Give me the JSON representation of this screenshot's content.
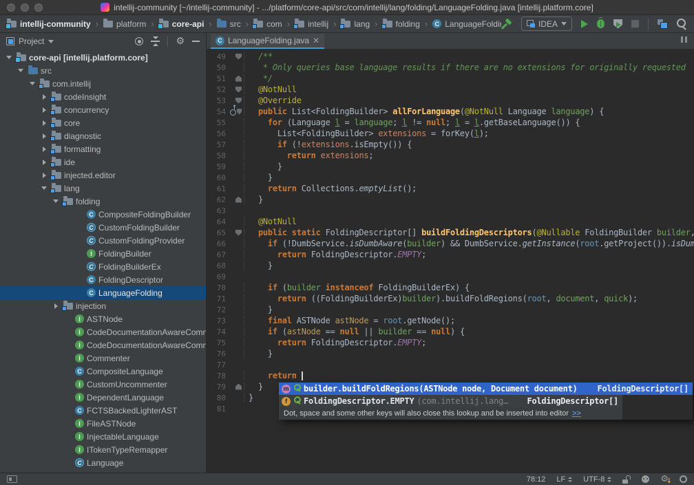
{
  "colors": {
    "editor_bg": "#2B2B2B",
    "panel_bg": "#3C3F41",
    "tab_underline": "#3C9CD7",
    "popup_selection": "#2F65CA",
    "tree_selection": "#15497A",
    "run_green": "#4DA54D",
    "keyword_orange": "#CC7832",
    "comment_green": "#629755",
    "annotation_yellow": "#BBB529"
  },
  "title_bar": {
    "title": "intellij-community [~/intellij-community] - .../platform/core-api/src/com/intellij/lang/folding/LanguageFolding.java [intellij.platform.core]"
  },
  "navbar": {
    "breadcrumbs": [
      {
        "label": "intellij-community",
        "icon": "module-folder",
        "bold": true
      },
      {
        "label": "platform",
        "icon": "folder"
      },
      {
        "label": "core-api",
        "icon": "module-folder",
        "bold": true
      },
      {
        "label": "src",
        "icon": "src-folder"
      },
      {
        "label": "com",
        "icon": "package-folder"
      },
      {
        "label": "intellij",
        "icon": "package-folder"
      },
      {
        "label": "lang",
        "icon": "package-folder"
      },
      {
        "label": "folding",
        "icon": "package-folder"
      },
      {
        "label": "LanguageFolding",
        "icon": "class"
      }
    ],
    "run_config": "IDEA"
  },
  "project_panel": {
    "title": "Project",
    "tree": [
      {
        "lvl": 0,
        "arrow": "d",
        "icon": "module-folder",
        "label": "core-api [intellij.platform.core]",
        "bold": true
      },
      {
        "lvl": 1,
        "arrow": "d",
        "icon": "src-folder",
        "label": "src"
      },
      {
        "lvl": 2,
        "arrow": "d",
        "icon": "package-folder",
        "label": "com.intellij"
      },
      {
        "lvl": 3,
        "arrow": "r",
        "icon": "package-folder",
        "label": "codeInsight"
      },
      {
        "lvl": 3,
        "arrow": "r",
        "icon": "package-folder",
        "label": "concurrency"
      },
      {
        "lvl": 3,
        "arrow": "r",
        "icon": "package-folder",
        "label": "core"
      },
      {
        "lvl": 3,
        "arrow": "r",
        "icon": "package-folder",
        "label": "diagnostic"
      },
      {
        "lvl": 3,
        "arrow": "r",
        "icon": "package-folder",
        "label": "formatting"
      },
      {
        "lvl": 3,
        "arrow": "r",
        "icon": "package-folder",
        "label": "ide"
      },
      {
        "lvl": 3,
        "arrow": "r",
        "icon": "package-folder",
        "label": "injected.editor"
      },
      {
        "lvl": 3,
        "arrow": "d",
        "icon": "package-folder",
        "label": "lang"
      },
      {
        "lvl": 4,
        "arrow": "d",
        "icon": "package-folder",
        "label": "folding"
      },
      {
        "lvl": 5,
        "arrow": "",
        "icon": "class",
        "label": "CompositeFoldingBuilder"
      },
      {
        "lvl": 5,
        "arrow": "",
        "icon": "abstract-class",
        "label": "CustomFoldingBuilder"
      },
      {
        "lvl": 5,
        "arrow": "",
        "icon": "abstract-class",
        "label": "CustomFoldingProvider"
      },
      {
        "lvl": 5,
        "arrow": "",
        "icon": "interface",
        "label": "FoldingBuilder"
      },
      {
        "lvl": 5,
        "arrow": "",
        "icon": "abstract-class",
        "label": "FoldingBuilderEx"
      },
      {
        "lvl": 5,
        "arrow": "",
        "icon": "class",
        "label": "FoldingDescriptor"
      },
      {
        "lvl": 5,
        "arrow": "",
        "icon": "class",
        "label": "LanguageFolding",
        "sel": true
      },
      {
        "lvl": 4,
        "arrow": "r",
        "icon": "package-folder",
        "label": "injection"
      },
      {
        "lvl": 4,
        "arrow": "",
        "icon": "interface",
        "label": "ASTNode"
      },
      {
        "lvl": 4,
        "arrow": "",
        "icon": "interface",
        "label": "CodeDocumentationAwareCommenter"
      },
      {
        "lvl": 4,
        "arrow": "",
        "icon": "interface",
        "label": "CodeDocumentationAwareCommenterEx"
      },
      {
        "lvl": 4,
        "arrow": "",
        "icon": "interface",
        "label": "Commenter"
      },
      {
        "lvl": 4,
        "arrow": "",
        "icon": "class",
        "label": "CompositeLanguage"
      },
      {
        "lvl": 4,
        "arrow": "",
        "icon": "interface",
        "label": "CustomUncommenter"
      },
      {
        "lvl": 4,
        "arrow": "",
        "icon": "interface",
        "label": "DependentLanguage"
      },
      {
        "lvl": 4,
        "arrow": "",
        "icon": "class",
        "label": "FCTSBackedLighterAST"
      },
      {
        "lvl": 4,
        "arrow": "",
        "icon": "interface",
        "label": "FileASTNode"
      },
      {
        "lvl": 4,
        "arrow": "",
        "icon": "interface",
        "label": "InjectableLanguage"
      },
      {
        "lvl": 4,
        "arrow": "",
        "icon": "interface",
        "label": "ITokenTypeRemapper"
      },
      {
        "lvl": 4,
        "arrow": "",
        "icon": "abstract-class",
        "label": "Language"
      }
    ]
  },
  "editor": {
    "tab": "LanguageFolding.java",
    "lines": [
      {
        "n": 49,
        "f": "s",
        "t": [
          [
            "p",
            "  "
          ],
          [
            "c",
            "/**"
          ]
        ]
      },
      {
        "n": 50,
        "t": [
          [
            "c",
            "   * Only queries base language results if there are no extensions for originally requested "
          ]
        ]
      },
      {
        "n": 51,
        "f": "e",
        "t": [
          [
            "c",
            "   */"
          ]
        ]
      },
      {
        "n": 52,
        "f": "s",
        "t": [
          [
            "p",
            "  "
          ],
          [
            "a",
            "@NotNull"
          ]
        ]
      },
      {
        "n": 53,
        "f": "s",
        "t": [
          [
            "p",
            "  "
          ],
          [
            "a",
            "@Override"
          ]
        ]
      },
      {
        "n": 54,
        "f": "s",
        "o": true,
        "t": [
          [
            "p",
            "  "
          ],
          [
            "k",
            "public"
          ],
          [
            "p",
            " List<FoldingBuilder> "
          ],
          [
            "m",
            "allForLanguage"
          ],
          [
            "p",
            "("
          ],
          [
            "a",
            "@NotNull"
          ],
          [
            "p",
            " Language "
          ],
          [
            "g",
            "language"
          ],
          [
            "p",
            ") {"
          ]
        ]
      },
      {
        "n": 55,
        "t": [
          [
            "p",
            "    "
          ],
          [
            "k",
            "for"
          ],
          [
            "p",
            " (Language "
          ],
          [
            "u",
            "l"
          ],
          [
            "p",
            " = "
          ],
          [
            "g",
            "language"
          ],
          [
            "p",
            "; "
          ],
          [
            "u",
            "l"
          ],
          [
            "p",
            " != "
          ],
          [
            "k",
            "null"
          ],
          [
            "p",
            "; "
          ],
          [
            "u",
            "l"
          ],
          [
            "p",
            " = "
          ],
          [
            "u",
            "l"
          ],
          [
            "p",
            ".getBaseLanguage()) {"
          ]
        ]
      },
      {
        "n": 56,
        "t": [
          [
            "p",
            "      List<FoldingBuilder> "
          ],
          [
            "s",
            "extensions"
          ],
          [
            "p",
            " = forKey("
          ],
          [
            "u",
            "l"
          ],
          [
            "p",
            ");"
          ]
        ]
      },
      {
        "n": 57,
        "t": [
          [
            "p",
            "      "
          ],
          [
            "k",
            "if"
          ],
          [
            "p",
            " (!"
          ],
          [
            "s",
            "extensions"
          ],
          [
            "p",
            ".isEmpty()) {"
          ]
        ]
      },
      {
        "n": 58,
        "t": [
          [
            "p",
            "        "
          ],
          [
            "k",
            "return"
          ],
          [
            "p",
            " "
          ],
          [
            "s",
            "extensions"
          ],
          [
            "p",
            ";"
          ]
        ]
      },
      {
        "n": 59,
        "t": [
          [
            "p",
            "      }"
          ]
        ]
      },
      {
        "n": 60,
        "t": [
          [
            "p",
            "    }"
          ]
        ]
      },
      {
        "n": 61,
        "t": [
          [
            "p",
            "    "
          ],
          [
            "k",
            "return"
          ],
          [
            "p",
            " Collections."
          ],
          [
            "i",
            "emptyList"
          ],
          [
            "p",
            "();"
          ]
        ]
      },
      {
        "n": 62,
        "f": "e",
        "t": [
          [
            "p",
            "  }"
          ]
        ]
      },
      {
        "n": 63,
        "t": []
      },
      {
        "n": 64,
        "t": [
          [
            "p",
            "  "
          ],
          [
            "a",
            "@NotNull"
          ]
        ]
      },
      {
        "n": 65,
        "f": "s",
        "t": [
          [
            "p",
            "  "
          ],
          [
            "k",
            "public static"
          ],
          [
            "p",
            " FoldingDescriptor[] "
          ],
          [
            "m",
            "buildFoldingDescriptors"
          ],
          [
            "p",
            "("
          ],
          [
            "a",
            "@Nullable"
          ],
          [
            "p",
            " FoldingBuilder "
          ],
          [
            "g",
            "builder"
          ],
          [
            "p",
            ", "
          ]
        ]
      },
      {
        "n": 66,
        "t": [
          [
            "p",
            "    "
          ],
          [
            "k",
            "if"
          ],
          [
            "p",
            " (!DumbService."
          ],
          [
            "i",
            "isDumbAware"
          ],
          [
            "p",
            "("
          ],
          [
            "g",
            "builder"
          ],
          [
            "p",
            ") && DumbService."
          ],
          [
            "i",
            "getInstance"
          ],
          [
            "p",
            "("
          ],
          [
            "r",
            "root"
          ],
          [
            "p",
            ".getProject())."
          ],
          [
            "i",
            "isDumb"
          ],
          [
            "p",
            "()"
          ]
        ]
      },
      {
        "n": 67,
        "t": [
          [
            "p",
            "      "
          ],
          [
            "k",
            "return"
          ],
          [
            "p",
            " FoldingDescriptor."
          ],
          [
            "e",
            "EMPTY"
          ],
          [
            "p",
            ";"
          ]
        ]
      },
      {
        "n": 68,
        "t": [
          [
            "p",
            "    }"
          ]
        ]
      },
      {
        "n": 69,
        "t": []
      },
      {
        "n": 70,
        "t": [
          [
            "p",
            "    "
          ],
          [
            "k",
            "if"
          ],
          [
            "p",
            " ("
          ],
          [
            "g",
            "builder"
          ],
          [
            "p",
            " "
          ],
          [
            "k",
            "instanceof"
          ],
          [
            "p",
            " FoldingBuilderEx) {"
          ]
        ]
      },
      {
        "n": 71,
        "t": [
          [
            "p",
            "      "
          ],
          [
            "k",
            "return"
          ],
          [
            "p",
            " ((FoldingBuilderEx)"
          ],
          [
            "g",
            "builder"
          ],
          [
            "p",
            ").buildFoldRegions("
          ],
          [
            "r",
            "root"
          ],
          [
            "p",
            ", "
          ],
          [
            "g",
            "document"
          ],
          [
            "p",
            ", "
          ],
          [
            "g",
            "quick"
          ],
          [
            "p",
            ");"
          ]
        ]
      },
      {
        "n": 72,
        "t": [
          [
            "p",
            "    }"
          ]
        ]
      },
      {
        "n": 73,
        "t": [
          [
            "p",
            "    "
          ],
          [
            "k",
            "final"
          ],
          [
            "p",
            " ASTNode "
          ],
          [
            "d",
            "astNode"
          ],
          [
            "p",
            " = "
          ],
          [
            "r",
            "root"
          ],
          [
            "p",
            ".getNode();"
          ]
        ]
      },
      {
        "n": 74,
        "t": [
          [
            "p",
            "    "
          ],
          [
            "k",
            "if"
          ],
          [
            "p",
            " ("
          ],
          [
            "d",
            "astNode"
          ],
          [
            "p",
            " == "
          ],
          [
            "k",
            "null"
          ],
          [
            "p",
            " || "
          ],
          [
            "g",
            "builder"
          ],
          [
            "p",
            " == "
          ],
          [
            "k",
            "null"
          ],
          [
            "p",
            ") {"
          ]
        ]
      },
      {
        "n": 75,
        "t": [
          [
            "p",
            "      "
          ],
          [
            "k",
            "return"
          ],
          [
            "p",
            " FoldingDescriptor."
          ],
          [
            "e",
            "EMPTY"
          ],
          [
            "p",
            ";"
          ]
        ]
      },
      {
        "n": 76,
        "t": [
          [
            "p",
            "    }"
          ]
        ]
      },
      {
        "n": 77,
        "t": []
      },
      {
        "n": 78,
        "t": [
          [
            "p",
            "    "
          ],
          [
            "k",
            "return"
          ],
          [
            "p",
            " "
          ],
          [
            "x",
            ""
          ]
        ]
      },
      {
        "n": 79,
        "f": "e",
        "t": [
          [
            "p",
            "  }"
          ]
        ]
      },
      {
        "n": 80,
        "t": [
          [
            "p",
            "}"
          ]
        ]
      },
      {
        "n": 81,
        "t": []
      }
    ]
  },
  "completion_popup": {
    "items": [
      {
        "icon": "method",
        "text": "builder.buildFoldRegions(ASTNode node, Document document)",
        "detail": "",
        "type": "FoldingDescriptor[]",
        "selected": true
      },
      {
        "icon": "field",
        "text": "FoldingDescriptor.EMPTY",
        "detail": "(com.intellij.lang…",
        "type": "FoldingDescriptor[]",
        "selected": false
      }
    ],
    "hint": "Dot, space and some other keys will also close this lookup and be inserted into editor",
    "hint_link": ">>"
  },
  "status_bar": {
    "caret_position": "78:12",
    "line_separator": "LF",
    "encoding": "UTF-8"
  }
}
